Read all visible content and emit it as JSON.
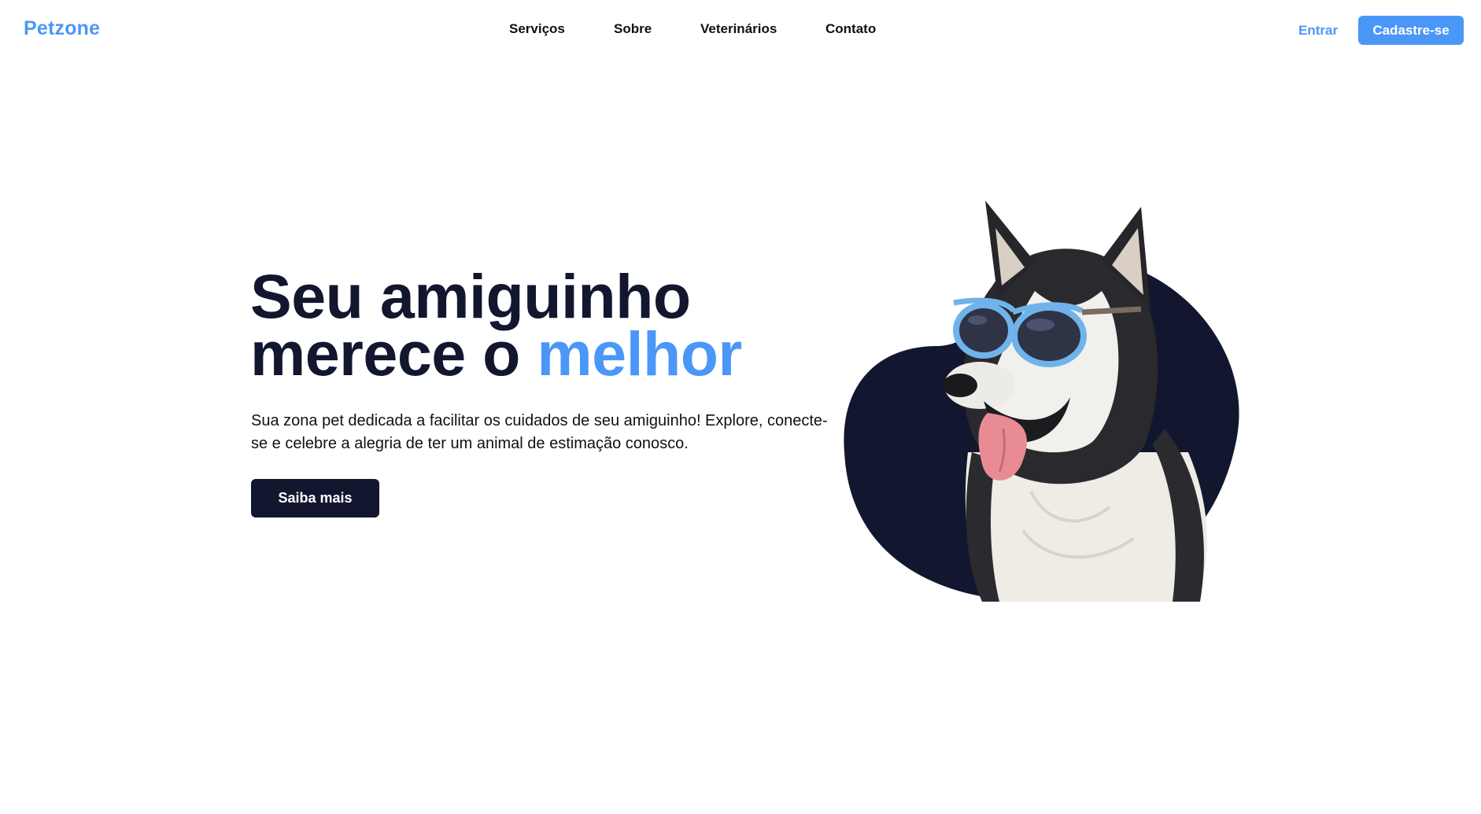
{
  "header": {
    "logo": "Petzone",
    "nav": [
      {
        "label": "Serviços"
      },
      {
        "label": "Sobre"
      },
      {
        "label": "Veterinários"
      },
      {
        "label": "Contato"
      }
    ],
    "login_label": "Entrar",
    "signup_label": "Cadastre-se"
  },
  "hero": {
    "title_line1": "Seu amiguinho",
    "title_line2_prefix": "merece o ",
    "title_line2_accent": "melhor",
    "description": "Sua zona pet dedicada a facilitar os cuidados de seu amiguinho! Explore, conecte-se e celebre a alegria de ter um animal de estimação conosco.",
    "cta_label": "Saiba mais",
    "image": "husky-with-sunglasses-on-navy-blob"
  },
  "colors": {
    "accent": "#4b97f7",
    "navy": "#12172f",
    "text": "#111111",
    "background": "#ffffff"
  }
}
